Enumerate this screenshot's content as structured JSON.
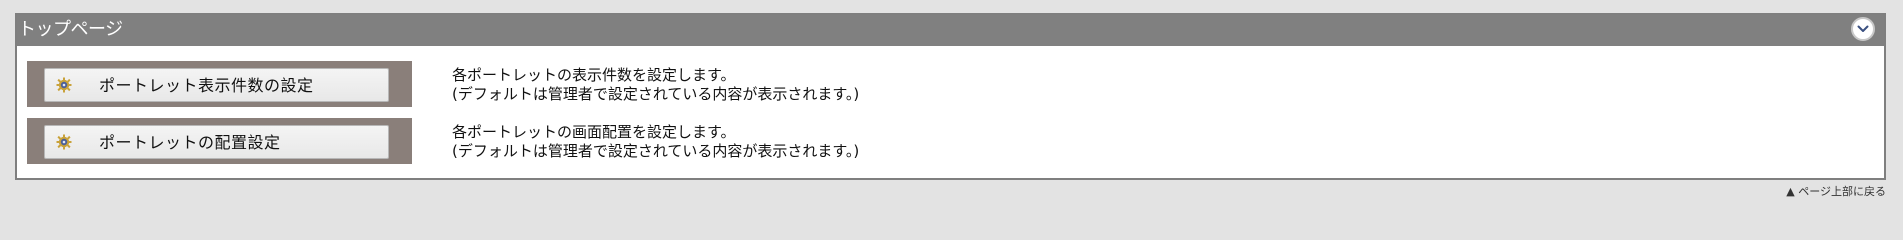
{
  "panel": {
    "title": "トップページ",
    "collapse_icon": "chevron-down-icon"
  },
  "settings": [
    {
      "label": "ポートレット表示件数の設定",
      "icon": "gear-icon",
      "description_line1": "各ポートレットの表示件数を設定します。",
      "description_line2": "(デフォルトは管理者で設定されている内容が表示されます。)"
    },
    {
      "label": "ポートレットの配置設定",
      "icon": "gear-icon",
      "description_line1": "各ポートレットの画面配置を設定します。",
      "description_line2": "(デフォルトは管理者で設定されている内容が表示されます。)"
    }
  ],
  "footer": {
    "back_to_top": "▲ ページ上部に戻る"
  },
  "colors": {
    "header_bg": "#808080",
    "button_frame": "#8a7f7a",
    "page_bg": "#e3e3e3"
  }
}
